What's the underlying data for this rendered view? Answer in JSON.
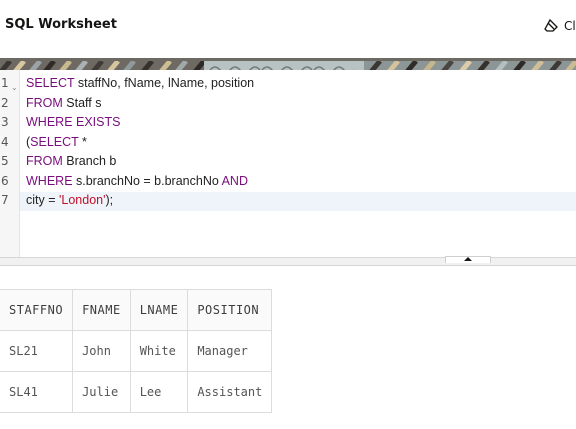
{
  "header": {
    "title": "SQL Worksheet",
    "clear_label": "Cl"
  },
  "editor": {
    "gutter": [
      {
        "num": "1",
        "fold": "⌄"
      },
      {
        "num": "2"
      },
      {
        "num": "3"
      },
      {
        "num": "4"
      },
      {
        "num": "5"
      },
      {
        "num": "6"
      },
      {
        "num": "7"
      }
    ],
    "lines": [
      [
        {
          "t": "SELECT",
          "k": "kw"
        },
        {
          "t": " staffNo, fName, lName, position",
          "k": ""
        }
      ],
      [
        {
          "t": "FROM",
          "k": "kw"
        },
        {
          "t": " Staff s",
          "k": ""
        }
      ],
      [
        {
          "t": "WHERE EXISTS",
          "k": "kw"
        }
      ],
      [
        {
          "t": "(",
          "k": ""
        },
        {
          "t": "SELECT",
          "k": "kw"
        },
        {
          "t": " *",
          "k": ""
        }
      ],
      [
        {
          "t": "FROM",
          "k": "kw"
        },
        {
          "t": " Branch b",
          "k": ""
        }
      ],
      [
        {
          "t": "WHERE",
          "k": "kw"
        },
        {
          "t": " s.branchNo = b.branchNo ",
          "k": ""
        },
        {
          "t": "AND",
          "k": "kw"
        }
      ],
      [
        {
          "t": "city = ",
          "k": ""
        },
        {
          "t": "'London'",
          "k": "str"
        },
        {
          "t": ");",
          "k": ""
        }
      ]
    ],
    "active_line": 7
  },
  "results": {
    "columns": [
      "STAFFNO",
      "FNAME",
      "LNAME",
      "POSITION"
    ],
    "rows": [
      [
        "SL21",
        "John",
        "White",
        "Manager"
      ],
      [
        "SL41",
        "Julie",
        "Lee",
        "Assistant"
      ]
    ]
  },
  "colors": {
    "keyword": "#7a0d7d",
    "string": "#c0112b",
    "active_line": "#eef4fa"
  }
}
